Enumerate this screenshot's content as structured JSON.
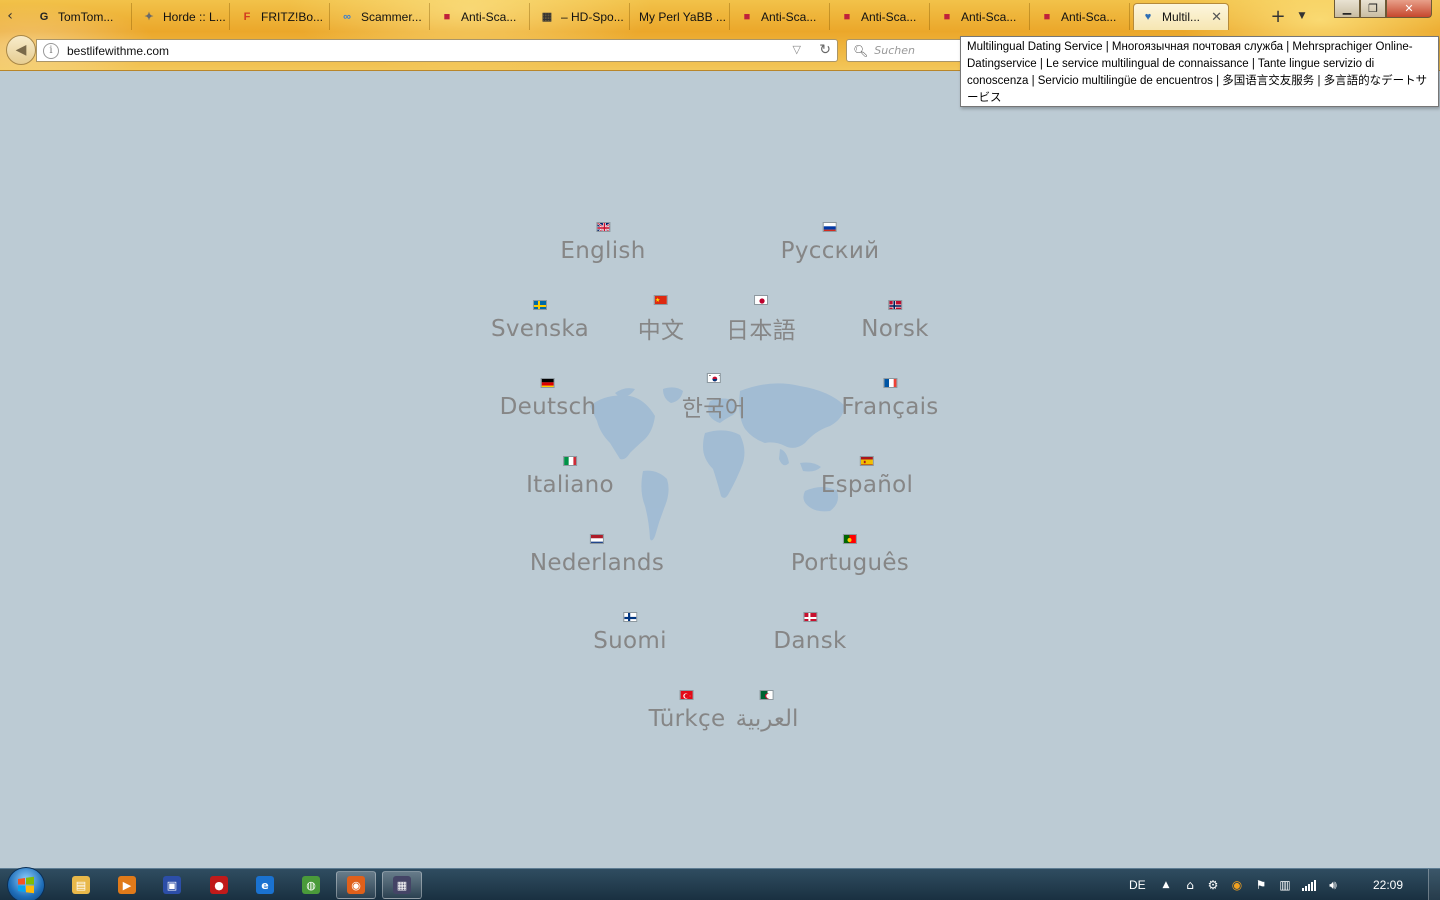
{
  "browser": {
    "tabs": [
      {
        "label": "TomTom...",
        "icon": "tomtom-icon",
        "color": "#222222",
        "glyph": "G"
      },
      {
        "label": "Horde :: L...",
        "icon": "horde-icon",
        "color": "#6a6a6a",
        "glyph": "✦"
      },
      {
        "label": "FRITZ!Bo...",
        "icon": "fritzbox-icon",
        "color": "#d23a1e",
        "glyph": "F"
      },
      {
        "label": "Scammer...",
        "icon": "scammer-icon",
        "color": "#3a7fd0",
        "glyph": "∞"
      },
      {
        "label": "Anti-Sca...",
        "icon": "anti-scam-icon",
        "color": "#c0203a",
        "glyph": "■"
      },
      {
        "label": "– HD-Spo...",
        "icon": "hd-sport-icon",
        "color": "#333333",
        "glyph": "▦"
      },
      {
        "label": "My Perl YaBB ...",
        "icon": "",
        "color": "",
        "glyph": ""
      },
      {
        "label": "Anti-Sca...",
        "icon": "anti-scam-icon",
        "color": "#c0203a",
        "glyph": "■"
      },
      {
        "label": "Anti-Sca...",
        "icon": "anti-scam-icon",
        "color": "#c0203a",
        "glyph": "■"
      },
      {
        "label": "Anti-Sca...",
        "icon": "anti-scam-icon",
        "color": "#c0203a",
        "glyph": "■"
      },
      {
        "label": "Anti-Sca...",
        "icon": "anti-scam-icon",
        "color": "#c0203a",
        "glyph": "■"
      },
      {
        "label": "Multil...",
        "icon": "heart-icon",
        "color": "#2f6fb5",
        "glyph": "♥"
      }
    ],
    "active_tab_index": 11,
    "new_tab_glyph": "+",
    "url": "bestlifewithme.com",
    "search_placeholder": "Suchen",
    "tooltip": "Multilingual Dating Service | Многоязычная почтовая служба | Mehrsprachiger Online-Datingservice | Le service multilingual de connaissance | Tante lingue servizio di conoscenza | Servicio multilingüe de encuentros | 多国语言交友服务 | 多言語的なデートサービス"
  },
  "languages": [
    {
      "label": "English",
      "flag": "gb",
      "slug": "english"
    },
    {
      "label": "Русский",
      "flag": "ru",
      "slug": "russian"
    },
    {
      "label": "Svenska",
      "flag": "se",
      "slug": "swedish"
    },
    {
      "label": "中文",
      "flag": "cn",
      "slug": "chinese"
    },
    {
      "label": "日本語",
      "flag": "jp",
      "slug": "japanese"
    },
    {
      "label": "Norsk",
      "flag": "no",
      "slug": "norwegian"
    },
    {
      "label": "Deutsch",
      "flag": "de",
      "slug": "german"
    },
    {
      "label": "한국어",
      "flag": "kr",
      "slug": "korean"
    },
    {
      "label": "Français",
      "flag": "fr",
      "slug": "french"
    },
    {
      "label": "Italiano",
      "flag": "it",
      "slug": "italian"
    },
    {
      "label": "Español",
      "flag": "es",
      "slug": "spanish"
    },
    {
      "label": "Nederlands",
      "flag": "nl",
      "slug": "dutch"
    },
    {
      "label": "Português",
      "flag": "pt",
      "slug": "portuguese"
    },
    {
      "label": "Suomi",
      "flag": "fi",
      "slug": "finnish"
    },
    {
      "label": "Dansk",
      "flag": "dk",
      "slug": "danish"
    },
    {
      "label": "Türkçe",
      "flag": "tr",
      "slug": "turkish"
    },
    {
      "label": "العربية",
      "flag": "dz",
      "slug": "arabic"
    }
  ],
  "taskbar": {
    "items": [
      {
        "name": "explorer-icon",
        "color": "#e8b84a",
        "glyph": "▤"
      },
      {
        "name": "media-player-icon",
        "color": "#e07a1a",
        "glyph": "▶"
      },
      {
        "name": "floppy-icon",
        "color": "#2c4ea8",
        "glyph": "▣"
      },
      {
        "name": "red-app-icon",
        "color": "#c01a1a",
        "glyph": "●"
      },
      {
        "name": "blue-app-icon",
        "color": "#1a72d0",
        "glyph": "e"
      },
      {
        "name": "green-globe-icon",
        "color": "#4a9a3a",
        "glyph": "◍"
      },
      {
        "name": "firefox-icon",
        "color": "#e0601a",
        "glyph": "◉"
      },
      {
        "name": "terminal-app-icon",
        "color": "#444466",
        "glyph": "▦"
      }
    ],
    "active_index": 6,
    "lang_indicator": "DE",
    "clock": "22:09"
  },
  "colors": {
    "page_bg": "#bccbd4",
    "label": "#868686",
    "map": "#9ebad3"
  }
}
